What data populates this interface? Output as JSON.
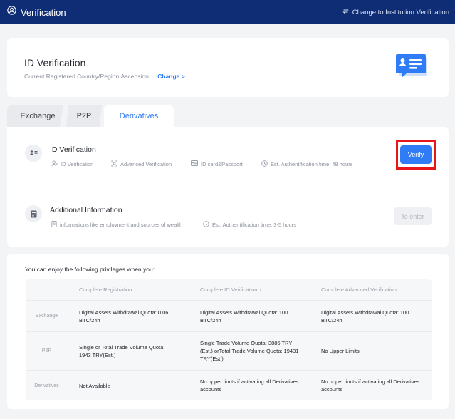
{
  "header": {
    "title": "Verification",
    "switch_label": "Change to Institution Verification"
  },
  "id_card": {
    "title": "ID Verification",
    "region_text": "Current Registered Country/Region:Ascension",
    "change_label": "Change >"
  },
  "tabs": [
    {
      "label": "Exchange",
      "active": false
    },
    {
      "label": "P2P",
      "active": false
    },
    {
      "label": "Derivatives",
      "active": true
    }
  ],
  "verification": {
    "id_row": {
      "title": "ID Verification",
      "meta": [
        "ID Verification",
        "Advanced Verification",
        "ID card&Passport",
        "Est. Authentification time: 48 hours"
      ],
      "button_label": "Verify"
    },
    "additional_row": {
      "title": "Additional Information",
      "meta": [
        "informations like employment and sources of wealth",
        "Est. Authentification time: 3-5 hours"
      ],
      "button_label": "To enter"
    }
  },
  "privileges": {
    "heading": "You can enjoy the following privileges when you:",
    "columns": [
      "",
      "Complete Registration",
      "Complete ID Verification ↕",
      "Complete Advanced Verification ↕"
    ],
    "rows": [
      {
        "label": "Exchange",
        "cells": [
          "Digital Assets Withdrawal Quota: 0.06 BTC/24h",
          "Digital Assets Withdrawal Quota: 100 BTC/24h",
          "Digital Assets Withdrawal Quota: 100 BTC/24h"
        ]
      },
      {
        "label": "P2P",
        "cells": [
          "Single or Total Trade Volume Quota: 1943 TRY(Est.)",
          "Single Trade Volume Quota: 3886 TRY (Est.) orTotal Trade Volume Quota: 19431 TRY(Est.)",
          "No Upper Limits"
        ]
      },
      {
        "label": "Derivatives",
        "cells": [
          "Not Available",
          "No upper limits if activating all Derivatives accounts",
          "No upper limits if activating all Derivatives accounts"
        ]
      }
    ]
  },
  "colors": {
    "header_bg": "#0f2d75",
    "accent": "#2f7cf6",
    "highlight": "#e8161a"
  }
}
